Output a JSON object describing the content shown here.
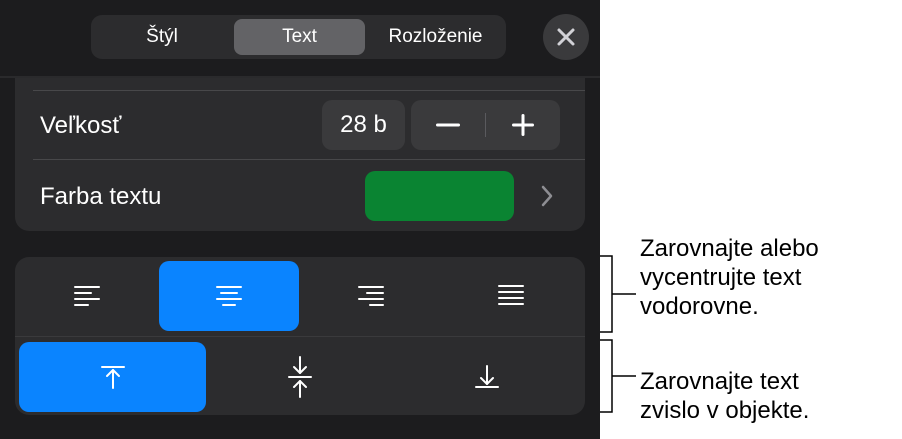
{
  "tabs": [
    {
      "label": "Štýl",
      "active": false
    },
    {
      "label": "Text",
      "active": true
    },
    {
      "label": "Rozloženie",
      "active": false
    }
  ],
  "close_icon": "xmark-icon",
  "size_row": {
    "label": "Veľkosť",
    "value": "28 b",
    "decrement_icon": "minus-icon",
    "increment_icon": "plus-icon"
  },
  "color_row": {
    "label": "Farba textu",
    "swatch_color": "#0a8432",
    "chevron_icon": "chevron-right-icon"
  },
  "horizontal_alignment": {
    "options": [
      "align-left-icon",
      "align-center-icon",
      "align-right-icon",
      "align-justify-icon"
    ],
    "selected": "align-center-icon"
  },
  "vertical_alignment": {
    "options": [
      "align-top-icon",
      "align-middle-icon",
      "align-bottom-icon"
    ],
    "selected": "align-top-icon"
  },
  "callouts": {
    "horizontal": "Zarovnajte alebo\nvycentrujte text\nvodorovne.",
    "vertical": "Zarovnajte text\nzvislo v objekte."
  },
  "colors": {
    "accent": "#0a84ff",
    "panel_background": "#1c1c1e",
    "card_background": "#2c2c2e"
  }
}
